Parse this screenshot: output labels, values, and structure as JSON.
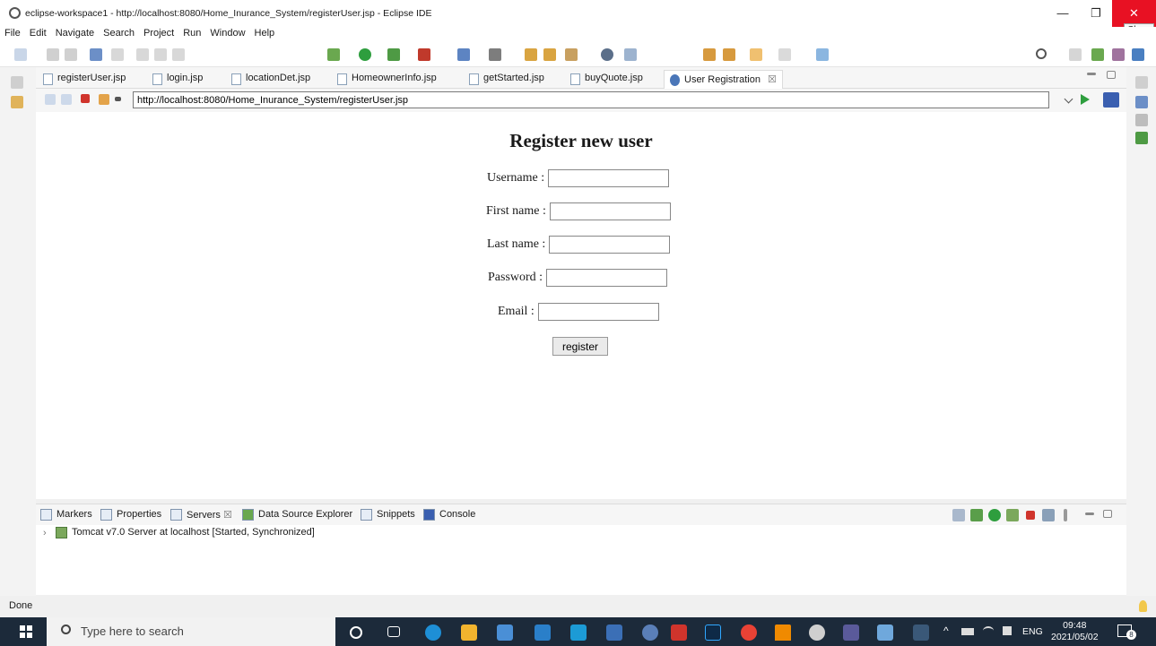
{
  "window": {
    "title": "eclipse-workspace1 - http://localhost:8080/Home_Inurance_System/registerUser.jsp - Eclipse IDE",
    "minimize_glyph": "—",
    "restore_glyph": "❐",
    "close_glyph": "✕",
    "close_tooltip": "Close"
  },
  "menu": [
    "File",
    "Edit",
    "Navigate",
    "Search",
    "Project",
    "Run",
    "Window",
    "Help"
  ],
  "editor_tabs": [
    {
      "label": "registerUser.jsp",
      "icon": "jsp-file-icon"
    },
    {
      "label": "login.jsp",
      "icon": "jsp-file-icon"
    },
    {
      "label": "locationDet.jsp",
      "icon": "jsp-file-icon"
    },
    {
      "label": "HomeownerInfo.jsp",
      "icon": "jsp-file-icon"
    },
    {
      "label": "getStarted.jsp",
      "icon": "jsp-file-icon"
    },
    {
      "label": "buyQuote.jsp",
      "icon": "jsp-file-icon"
    },
    {
      "label": "User Registration",
      "icon": "globe-icon",
      "active": true,
      "close": "☒"
    }
  ],
  "browser": {
    "url": "http://localhost:8080/Home_Inurance_System/registerUser.jsp"
  },
  "form": {
    "heading": "Register new user",
    "username_label": "Username :",
    "firstname_label": "First name :",
    "lastname_label": "Last name :",
    "password_label": "Password :",
    "email_label": "Email :",
    "submit_label": "register"
  },
  "bottom_panel": {
    "tabs": [
      "Markers",
      "Properties",
      "Servers",
      "Data Source Explorer",
      "Snippets",
      "Console"
    ],
    "active_tab": "Servers",
    "server_row": "Tomcat v7.0 Server at localhost  [Started, Synchronized]"
  },
  "status": "Done",
  "taskbar": {
    "search_placeholder": "Type here to search",
    "lang": "ENG",
    "time": "09:48",
    "date": "2021/05/02",
    "notification_count": "8"
  }
}
